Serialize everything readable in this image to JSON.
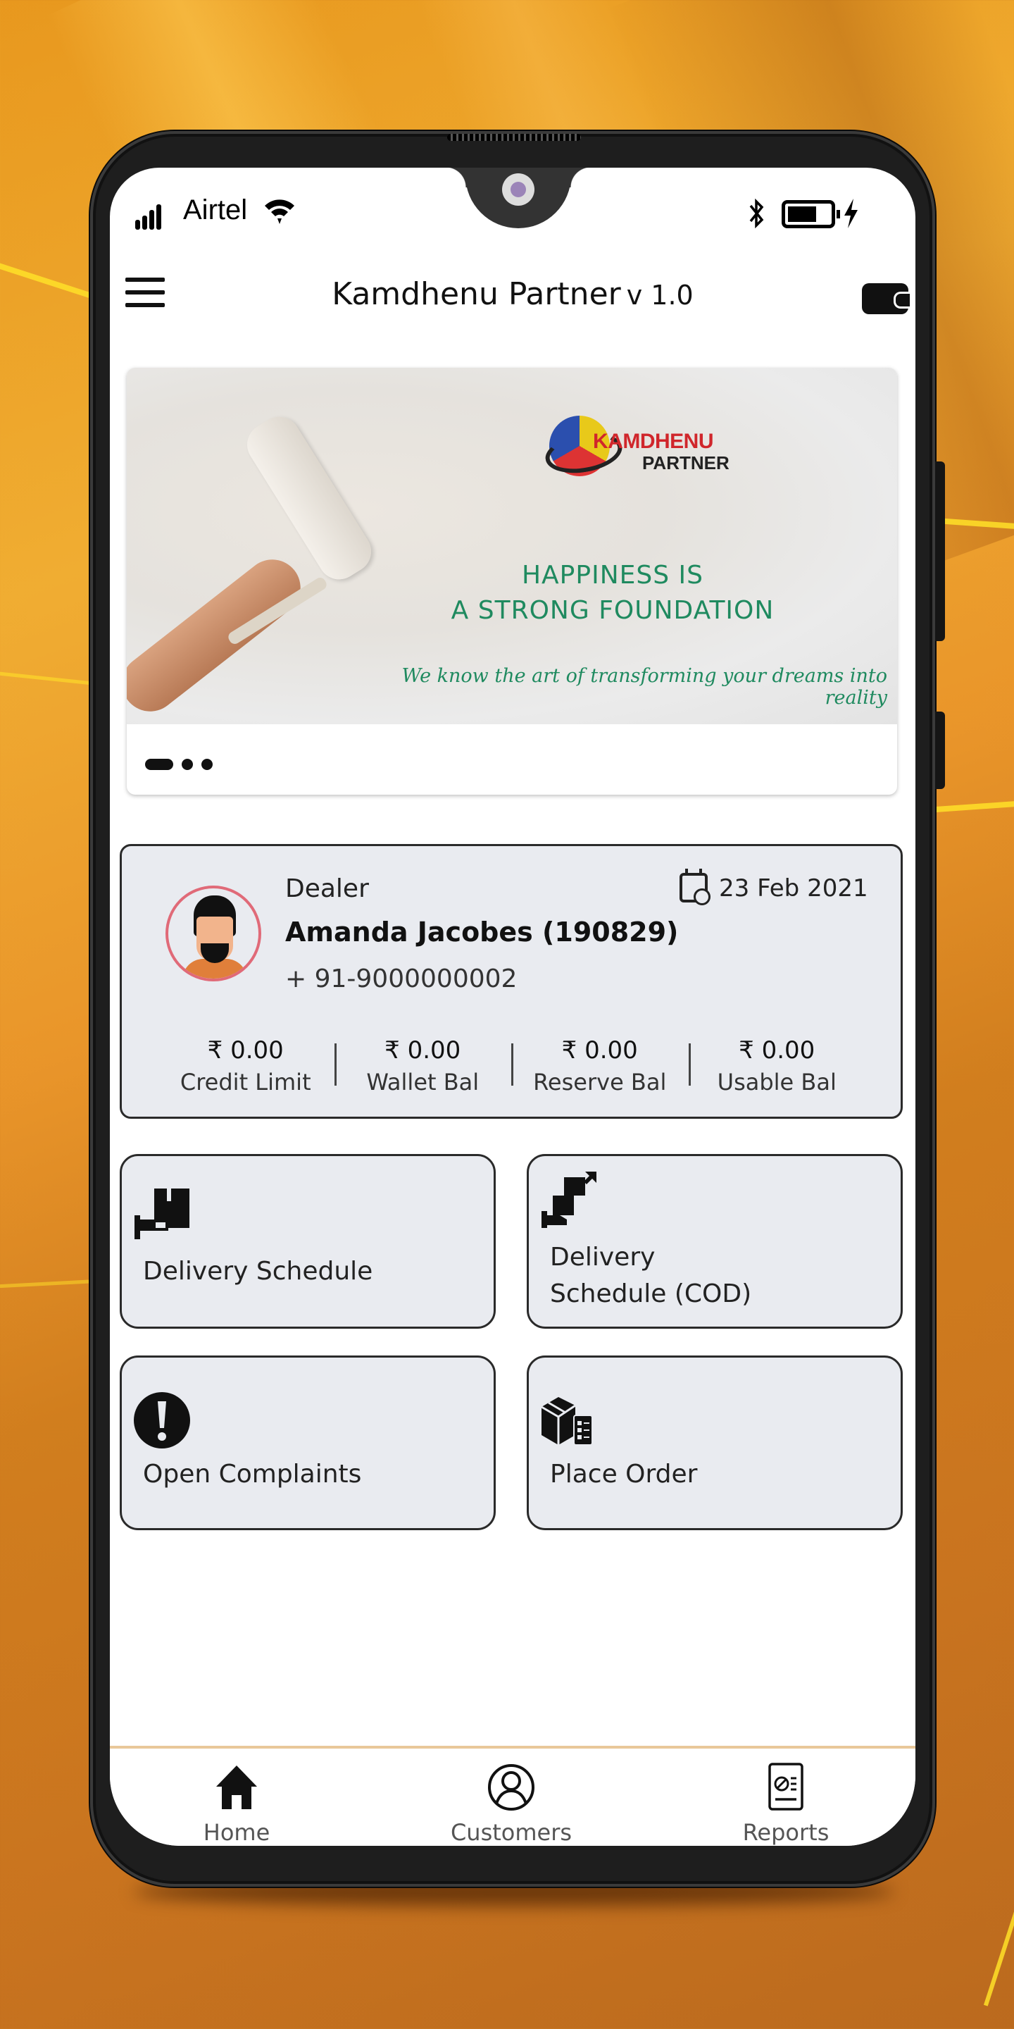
{
  "status_bar": {
    "carrier": "Airtel",
    "icons": [
      "signal-icon",
      "wifi-icon",
      "bluetooth-icon",
      "battery-icon",
      "charging-icon"
    ]
  },
  "header": {
    "title": "Kamdhenu Partner",
    "version": "v 1.0",
    "menu_icon": "hamburger-menu-icon",
    "wallet_icon": "wallet-icon"
  },
  "banner": {
    "logo_name": "KAMDHENU",
    "logo_sub": "PARTNER",
    "headline_1": "HAPPINESS IS",
    "headline_2": "A STRONG FOUNDATION",
    "tagline": "We know the art of transforming your dreams into reality",
    "slides_total": 3,
    "active_slide": 1,
    "accent_color": "#1f8a5f"
  },
  "dealer": {
    "role": "Dealer",
    "name": "Amanda Jacobes (190829)",
    "phone": "+ 91-9000000002",
    "date": "23 Feb 2021",
    "balances": [
      {
        "value": "₹ 0.00",
        "label": "Credit Limit"
      },
      {
        "value": "₹ 0.00",
        "label": "Wallet Bal"
      },
      {
        "value": "₹ 0.00",
        "label": "Reserve Bal"
      },
      {
        "value": "₹ 0.00",
        "label": "Usable Bal"
      }
    ]
  },
  "tiles": [
    {
      "label": "Delivery Schedule",
      "icon": "delivery-hand-box-icon"
    },
    {
      "label_1": "Delivery",
      "label_2": "Schedule (COD)",
      "icon": "delivery-cod-icon"
    },
    {
      "label": "Open Complaints",
      "icon": "exclamation-circle-icon"
    },
    {
      "label": "Place Order",
      "icon": "box-clipboard-icon"
    }
  ],
  "bottom_nav": [
    {
      "label": "Home",
      "icon": "home-icon",
      "active": true
    },
    {
      "label": "Customers",
      "icon": "user-circle-icon",
      "active": false
    },
    {
      "label": "Reports",
      "icon": "report-icon",
      "active": false
    }
  ],
  "colors": {
    "card_bg": "#e9ebf0",
    "nav_border": "#e9c89a",
    "avatar_ring": "#e06a78"
  }
}
